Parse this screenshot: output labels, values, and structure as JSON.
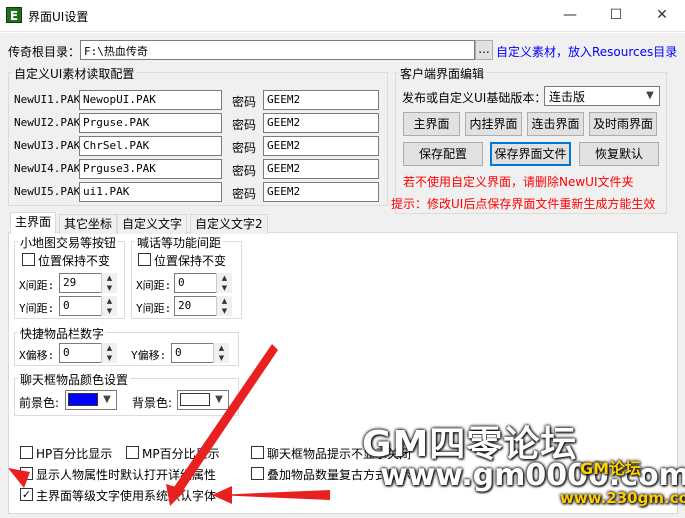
{
  "window": {
    "title": "界面UI设置",
    "icon_letter": "E",
    "minimize": "—",
    "maximize": "☐",
    "close": "✕"
  },
  "root_dir": {
    "label": "传奇根目录：",
    "value": "F:\\热血传奇",
    "browse": "...",
    "hint": "自定义素材，放入Resources目录"
  },
  "material_group": {
    "title": "自定义UI素材读取配置",
    "password_label": "密码",
    "rows": [
      {
        "label": "NewUI1.PAK",
        "file": "NewopUI.PAK",
        "password": "GEEM2"
      },
      {
        "label": "NewUI2.PAK",
        "file": "Prguse.PAK",
        "password": "GEEM2"
      },
      {
        "label": "NewUI3.PAK",
        "file": "ChrSel.PAK",
        "password": "GEEM2"
      },
      {
        "label": "NewUI4.PAK",
        "file": "Prguse3.PAK",
        "password": "GEEM2"
      },
      {
        "label": "NewUI5.PAK",
        "file": "ui1.PAK",
        "password": "GEEM2"
      }
    ]
  },
  "client_group": {
    "title": "客户端界面编辑",
    "version_label": "发布或自定义UI基础版本：",
    "version_value": "连击版",
    "buttons": [
      "主界面",
      "内挂界面",
      "连击界面",
      "及时雨界面"
    ],
    "save_config": "保存配置",
    "save_ui_file": "保存界面文件",
    "restore_default": "恢复默认",
    "warning": "若不使用自定义界面，请删除NewUI文件夹"
  },
  "tip": "提示：修改UI后点保存界面文件重新生成方能生效",
  "tabs": [
    "主界面",
    "其它坐标",
    "自定义文字",
    "自定义文字2"
  ],
  "minimap_group": {
    "title": "小地图交易等按钮",
    "keep_pos": "位置保持不变",
    "x_label": "X间距:",
    "x_value": "29",
    "y_label": "Y间距:",
    "y_value": "0"
  },
  "shout_group": {
    "title": "喊话等功能间距",
    "keep_pos": "位置保持不变",
    "x_label": "X间距:",
    "x_value": "0",
    "y_label": "Y间距:",
    "y_value": "20"
  },
  "quickbar_group": {
    "title": "快捷物品栏数字",
    "x_label": "X偏移:",
    "x_value": "0",
    "y_label": "Y偏移:",
    "y_value": "0"
  },
  "chatcolor_group": {
    "title": "聊天框物品颜色设置",
    "fg_label": "前景色:",
    "fg_color": "#0000ff",
    "bg_label": "背景色:",
    "bg_color": "#ffffff"
  },
  "checkboxes": {
    "hp_percent": "HP百分比显示",
    "mp_percent": "MP百分比显示",
    "chat_item_tip": "聊天框物品提示不显示关闭",
    "show_detail": "显示人物属性时默认打开详细属性",
    "stack_count": "叠加物品数量复古方式显示",
    "system_font": "主界面等级文字使用系统默认字体",
    "checkmark": "✓"
  },
  "watermark": {
    "line1": "GM四零论坛",
    "line2": "www.gm0000.com",
    "line3": "GM论坛",
    "line4": "www.230gm.com"
  },
  "colors": {
    "arrow_red": "#e82020",
    "blue_link": "#0000ff",
    "red_text": "#ff0000"
  }
}
